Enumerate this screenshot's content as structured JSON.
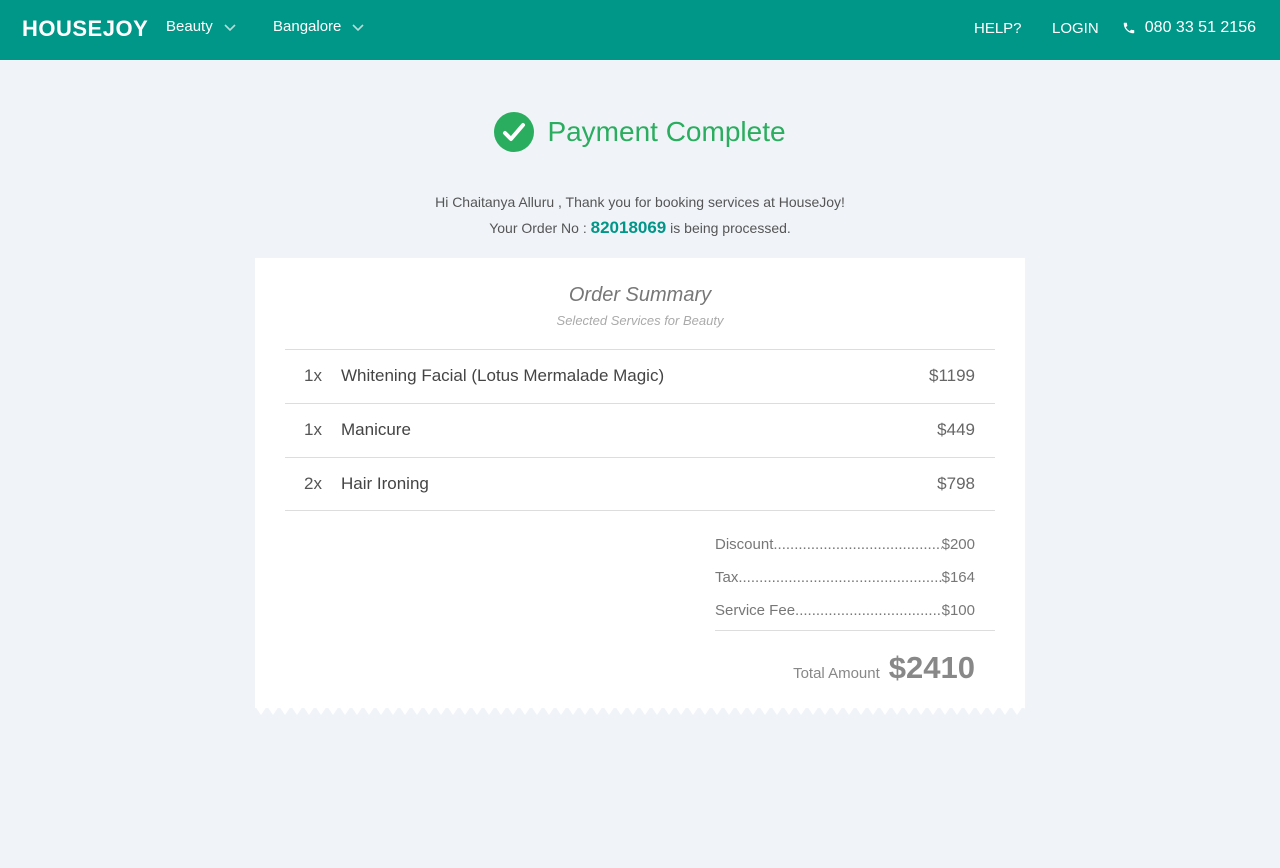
{
  "nav": {
    "logo": "HOUSEJOY",
    "category": "Beauty",
    "city": "Bangalore",
    "help": "HELP?",
    "login": "LOGIN",
    "phone": "080 33 51 2156"
  },
  "status": {
    "title": "Payment Complete",
    "greeting": "Hi Chaitanya Alluru , Thank you for booking services at HouseJoy!",
    "order_prefix": "Your Order No :",
    "order_no": "82018069",
    "order_suffix": "is being processed."
  },
  "summary": {
    "title": "Order Summary",
    "subtitle": "Selected Services for Beauty",
    "items": [
      {
        "qty": "1x",
        "name": "Whitening Facial (Lotus Mermalade Magic)",
        "price": "$1199"
      },
      {
        "qty": "1x",
        "name": "Manicure",
        "price": "$449"
      },
      {
        "qty": "2x",
        "name": "Hair Ironing",
        "price": "$798"
      }
    ],
    "charges": [
      {
        "label": "Discount",
        "dots": "...........................................",
        "value": "$200"
      },
      {
        "label": "Tax",
        "dots": "...................................................",
        "value": "$164"
      },
      {
        "label": "Service Fee",
        "dots": ".....................................",
        "value": "$100"
      }
    ],
    "total_label": "Total Amount",
    "total_value": "$2410"
  },
  "colors": {
    "navbar": "#009688",
    "success": "#2bad5f",
    "background": "#f0f4f8"
  }
}
